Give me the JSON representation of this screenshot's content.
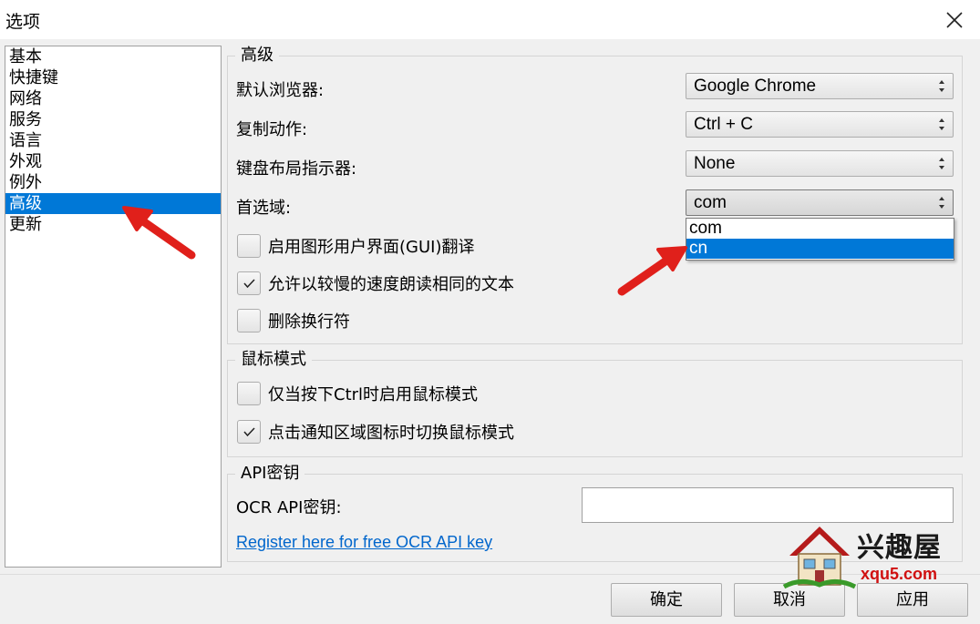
{
  "window": {
    "title": "选项"
  },
  "sidebar": {
    "items": [
      {
        "label": "基本"
      },
      {
        "label": "快捷键"
      },
      {
        "label": "网络"
      },
      {
        "label": "服务"
      },
      {
        "label": "语言"
      },
      {
        "label": "外观"
      },
      {
        "label": "例外"
      },
      {
        "label": "高级",
        "selected": true
      },
      {
        "label": "更新"
      }
    ]
  },
  "advanced": {
    "title": "高级",
    "default_browser": {
      "label": "默认浏览器:",
      "value": "Google Chrome"
    },
    "copy_action": {
      "label": "复制动作:",
      "value": "Ctrl + C"
    },
    "keyboard_layout_indicator": {
      "label": "键盘布局指示器:",
      "value": "None"
    },
    "preferred_domain": {
      "label": "首选域:",
      "value": "com",
      "options": [
        "com",
        "cn"
      ],
      "highlighted": "cn"
    },
    "checkboxes": [
      {
        "label": "启用图形用户界面(GUI)翻译",
        "checked": false
      },
      {
        "label": "允许以较慢的速度朗读相同的文本",
        "checked": true
      },
      {
        "label": "删除换行符",
        "checked": false
      }
    ]
  },
  "mouse_mode": {
    "title": "鼠标模式",
    "checkboxes": [
      {
        "label": "仅当按下Ctrl时启用鼠标模式",
        "checked": false
      },
      {
        "label": "点击通知区域图标时切换鼠标模式",
        "checked": true
      }
    ]
  },
  "api_key": {
    "title": "API密钥",
    "ocr_label": "OCR API密钥:",
    "ocr_value": "",
    "register_link": "Register here for free OCR API key"
  },
  "buttons": {
    "ok": "确定",
    "cancel": "取消",
    "apply": "应用"
  },
  "watermark": {
    "name": "兴趣屋",
    "url": "xqu5.com"
  },
  "colors": {
    "selection": "#0078d7",
    "annotation_arrow": "#e0201b",
    "link": "#0066cc"
  }
}
